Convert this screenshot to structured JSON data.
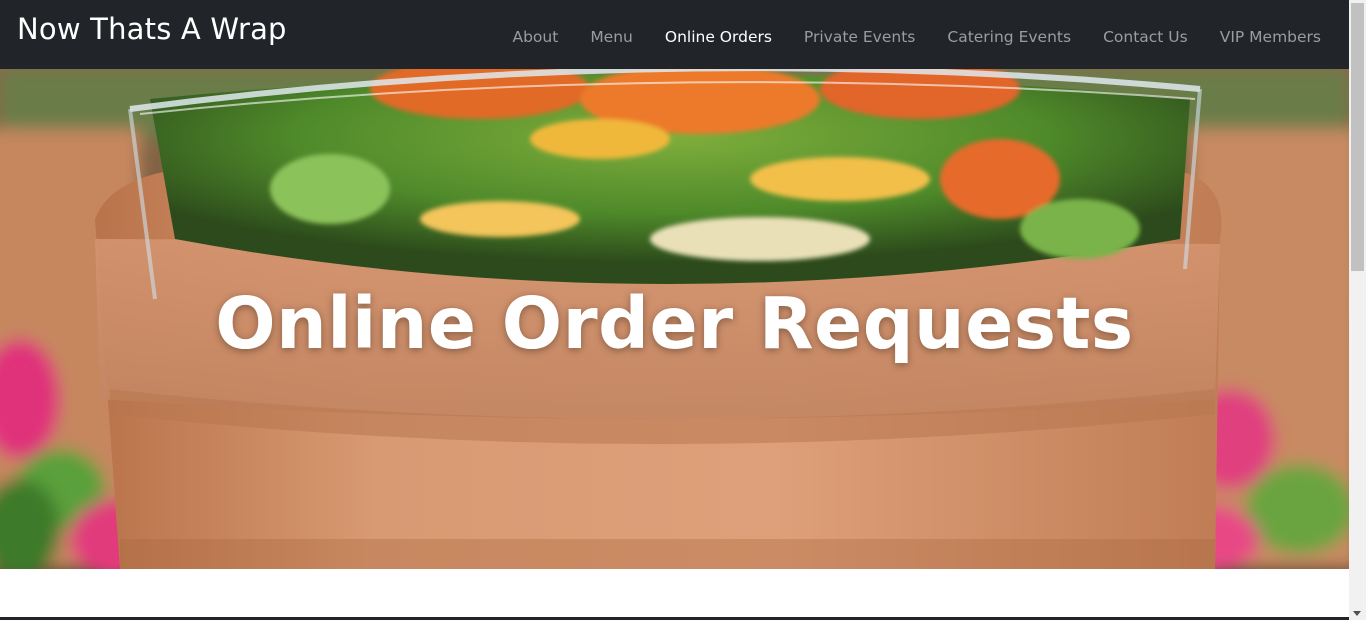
{
  "navbar": {
    "brand": "Now Thats A Wrap",
    "items": [
      {
        "label": "About"
      },
      {
        "label": "Menu"
      },
      {
        "label": "Online Orders",
        "active": true
      },
      {
        "label": "Private Events"
      },
      {
        "label": "Catering Events"
      },
      {
        "label": "Contact Us"
      },
      {
        "label": "VIP Members"
      }
    ]
  },
  "hero": {
    "title": "Online Order Requests",
    "image": "salad-in-terracotta-pot"
  },
  "colors": {
    "navbar_bg": "#212529",
    "nav_link": "#9a9da0",
    "nav_link_active": "#ffffff",
    "title": "#ffffff"
  }
}
